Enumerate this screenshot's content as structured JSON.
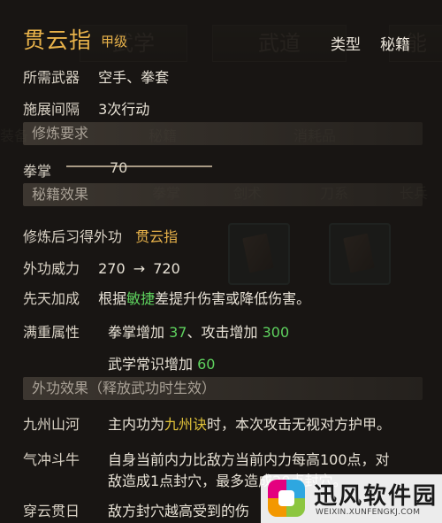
{
  "background": {
    "tab_left": "武学",
    "tab_mid": "武道",
    "tab_right": "能",
    "row1_left": "装备",
    "row1_mid1": "秘籍",
    "row1_mid2": "消耗品",
    "row2_items": [
      "拳掌",
      "剑术",
      "刀系",
      "长兵"
    ]
  },
  "header": {
    "title": "贯云指",
    "grade": "甲级",
    "type_label": "类型",
    "type_value": "秘籍"
  },
  "info": {
    "weapon_label": "所需武器",
    "weapon_value": "空手、拳套",
    "interval_label": "施展间隔",
    "interval_value": "3次行动"
  },
  "requirements": {
    "section_title": "修炼要求",
    "skill_label": "拳掌",
    "skill_value": "70",
    "skill_progress": 1.0
  },
  "effects": {
    "section_title": "秘籍效果",
    "learn_label": "修炼后习得外功",
    "learn_value": "贯云指",
    "power_label": "外功威力",
    "power_from": "270",
    "power_arrow": "→",
    "power_to": "720",
    "innate_label": "先天加成",
    "innate_pre": "根据",
    "innate_stat": "敏捷",
    "innate_post": "差提升伤害或降低伤害。",
    "maxed_label": "满重属性",
    "maxed_line1_a": "拳掌增加",
    "maxed_line1_a_val": "37",
    "maxed_line1_b": "、攻击增加",
    "maxed_line1_b_val": "300",
    "maxed_line2_a": "武学常识增加",
    "maxed_line2_a_val": "60"
  },
  "external": {
    "section_title": "外功效果（释放武功时生效）",
    "items": [
      {
        "name": "九州山河",
        "line1_pre": "主内功为",
        "line1_hl": "九州诀",
        "line1_post": "时，本次攻击无视对方护甲。",
        "line2": ""
      },
      {
        "name": "气冲斗牛",
        "line1_pre": "自身当前内力比敌方当前内力每高100点，对",
        "line1_hl": "",
        "line1_post": "",
        "line2": "敌造成1点封穴，最多造成20点封穴。"
      },
      {
        "name": "穿云贯日",
        "line1_pre": "敌方封穴越高受到的伤",
        "line1_hl": "",
        "line1_post": "",
        "line2": ""
      }
    ]
  },
  "watermark": {
    "name": "迅风软件园",
    "url": "WEIXIN.XUNFENGKJ.COM"
  }
}
